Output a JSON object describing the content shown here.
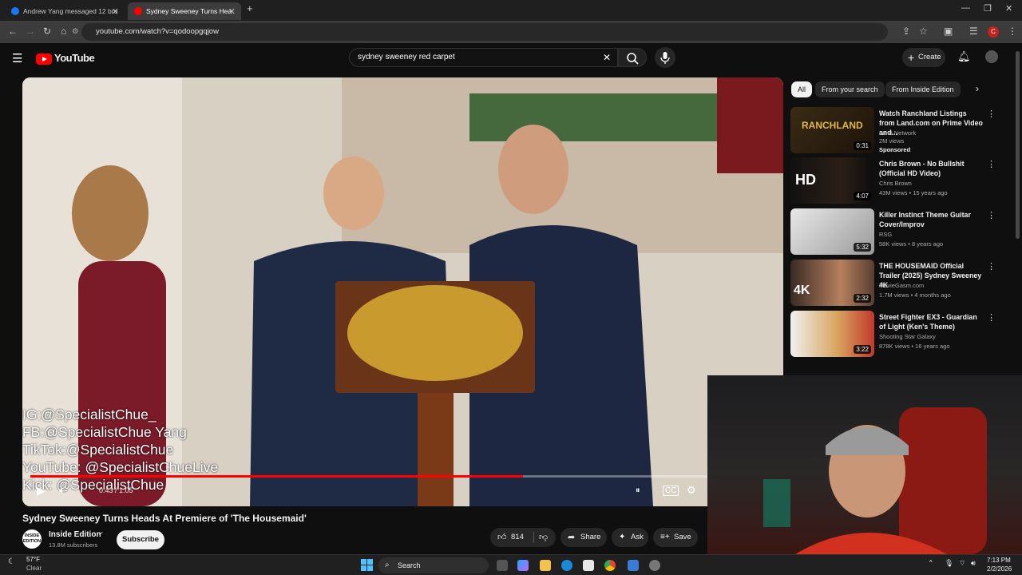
{
  "browser": {
    "tabs": [
      {
        "title": "Andrew Yang messaged 12 bro",
        "active": false
      },
      {
        "title": "Sydney Sweeney Turns Hea",
        "active": true
      }
    ],
    "url": "youtube.com/watch?v=qodoopgqjow",
    "profile_initial": "C"
  },
  "youtube": {
    "logo_text": "YouTube",
    "search_value": "sydney sweeney red carpet",
    "create_label": "Create",
    "video": {
      "overlay_lines": [
        "IG:@SpecialistChue_",
        "FB:@SpecialistChue Yang",
        "TikTok:@SpecialistChue",
        "YouTube: @SpecialistChueLive",
        "Kick: @SpecialistChue"
      ],
      "time": "0:43 / 1:05",
      "progress": 0.66,
      "title": "Sydney Sweeney Turns Heads At Premiere of 'The Housemaid'",
      "channel": "Inside Edition",
      "subscribers": "13.8M subscribers",
      "subscribe_label": "Subscribe",
      "likes": "814",
      "share_label": "Share",
      "ask_label": "Ask",
      "save_label": "Save"
    },
    "chips": [
      "All",
      "From your search",
      "From Inside Edition"
    ],
    "recommendations": [
      {
        "title": "Watch Ranchland Listings from Land.com on Prime Video and...",
        "channel": "Land Network",
        "stats": "2M views",
        "extra": "Sponsored",
        "duration": "0:31",
        "thumb_text": "RANCHLAND"
      },
      {
        "title": "Chris Brown - No Bullshit (Official HD Video)",
        "channel": "Chris Brown",
        "stats": "43M views • 15 years ago",
        "extra": "",
        "duration": "4:07",
        "thumb_text": "HD"
      },
      {
        "title": "Killer Instinct Theme Guitar Cover/Improv",
        "channel": "RSG",
        "stats": "58K views • 8 years ago",
        "extra": "",
        "duration": "5:32",
        "thumb_text": ""
      },
      {
        "title": "THE HOUSEMAID Official Trailer (2025) Sydney Sweeney 4K",
        "channel": "MovieGasm.com",
        "stats": "1.7M views • 4 months ago",
        "extra": "",
        "duration": "2:32",
        "thumb_text": "4K"
      },
      {
        "title": "Street Fighter EX3 - Guardian of Light (Ken's Theme)",
        "channel": "Shooting Star Galaxy",
        "stats": "878K views • 16 years ago",
        "extra": "",
        "duration": "3:22",
        "thumb_text": ""
      }
    ]
  },
  "taskbar": {
    "weather_temp": "57°F",
    "weather_desc": "Clear",
    "search_label": "Search",
    "time": "7:13 PM",
    "date": "2/2/2026"
  }
}
